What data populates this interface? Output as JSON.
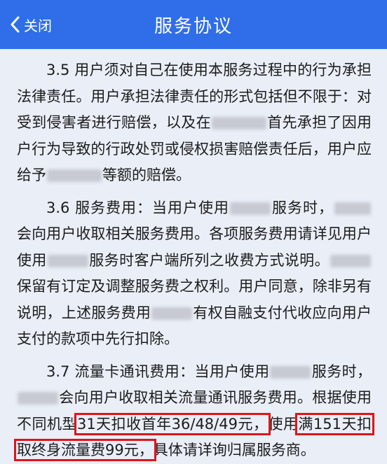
{
  "header": {
    "back_label": "关闭",
    "title": "服务协议",
    "icons": {
      "back": "chevron-left-icon"
    },
    "colors": {
      "bar": "#2f6ee8",
      "text": "#ffffff"
    }
  },
  "clauses": {
    "c35": {
      "t1": "3.5 用户须对自己在使用本服务过程中的行为承担法律责任。用户承担法律责任的形式包括但不限于：对受到侵害者进行赔偿，以及在",
      "t2": "首先承担了因用户行为导致的行政处罚或侵权损害赔偿责任后，用户应给予",
      "t3": "等额的赔偿。"
    },
    "c36": {
      "t1": "3.6 服务费用：当用户使用",
      "t2": "服务时，",
      "t3": "会向用户收取相关服务费用。各项服务费用请详见用户使用",
      "t4": "服务时客户端所列之收费方式说明。",
      "t5": "保留有订定及调整服务费之权利。用户同意，除非另有说明，上述服务费用",
      "t6": "有权自融支付代收应向用户支付的款项中先行扣除。"
    },
    "c37": {
      "t1": "3.7 流量卡通讯费用：当用户使用",
      "t2": "服务时，",
      "t3": "会向用户收取相关流量通讯服务费用。根据使用不同机型",
      "hl1": "31天扣收首年36/48/49元，",
      "t4": "使用",
      "hl2": "满151天扣取终身流量费99元，",
      "t5": "具体请详询归属服务商。"
    }
  },
  "highlight_color": "#e0141a"
}
